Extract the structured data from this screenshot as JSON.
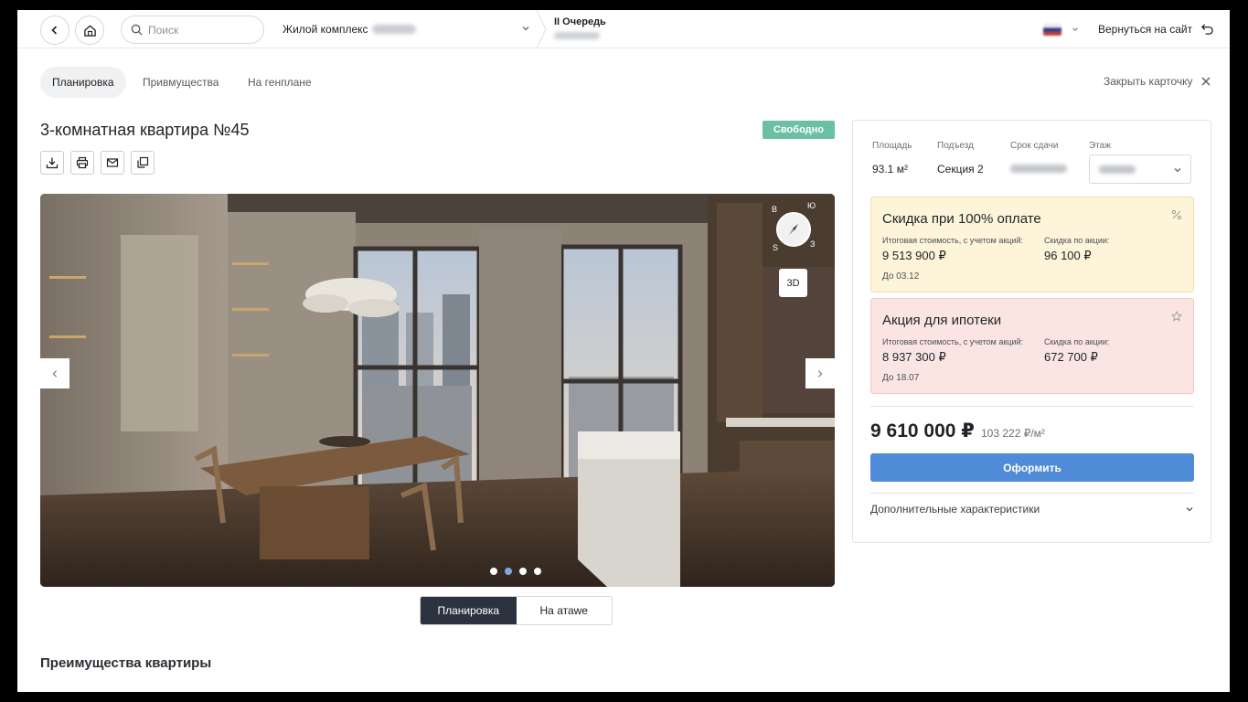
{
  "header": {
    "search_placeholder": "Поиск",
    "complex_label": "Жилой комплекс",
    "queue_label": "II Очередь",
    "back_to_site": "Вернуться на сайт"
  },
  "tabs": [
    {
      "label": "Планировка",
      "active": true
    },
    {
      "label": "Привмущества",
      "active": false
    },
    {
      "label": "На генплане",
      "active": false
    }
  ],
  "close_card": "Закрыть карточку",
  "apartment": {
    "title": "3-комнатная квартира №45",
    "status": "Свободно"
  },
  "toolbar_icons": [
    "download-icon",
    "print-icon",
    "mail-icon",
    "copy-icon"
  ],
  "photo": {
    "compass": {
      "n": "В",
      "e": "Ю",
      "w": "S",
      "s": "З"
    },
    "btn_3d": "3D",
    "slides": 4,
    "active_slide": 2
  },
  "view_switch": {
    "plan": "Планировка",
    "floor": "На атаwe"
  },
  "advantages_title": "Преимущества квартиры",
  "specs": {
    "area_label": "Площадь",
    "area_value": "93.1 м²",
    "entrance_label": "Подъезд",
    "entrance_value": "Секция 2",
    "deadline_label": "Срок сдачи",
    "floor_label": "Этаж"
  },
  "promos": [
    {
      "title": "Скидка при 100% оплате",
      "total_label": "Итоговая стоимость, с учетом акций:",
      "total_value": "9 513 900 ₽",
      "discount_label": "Скидка по акции:",
      "discount_value": "96 100 ₽",
      "date": "До 03.12",
      "icon": "percent-icon",
      "color": "#fdf4d9"
    },
    {
      "title": "Акция для ипотеки",
      "total_label": "Итоговая стоимость, с учетом акций:",
      "total_value": "8 937 300 ₽",
      "discount_label": "Скидка по акции:",
      "discount_value": "672 700 ₽",
      "date": "До 18.07",
      "icon": "star-icon",
      "color": "#fbe5e2"
    }
  ],
  "price": {
    "total": "9 610 000 ₽",
    "per_m2": "103 222 ₽/м²",
    "order_button": "Оформить"
  },
  "more_characteristics": "Дополнительные характеристики",
  "colors": {
    "accent": "#4f8bd6",
    "status": "#6bbfa4",
    "dark": "#2d3240"
  }
}
